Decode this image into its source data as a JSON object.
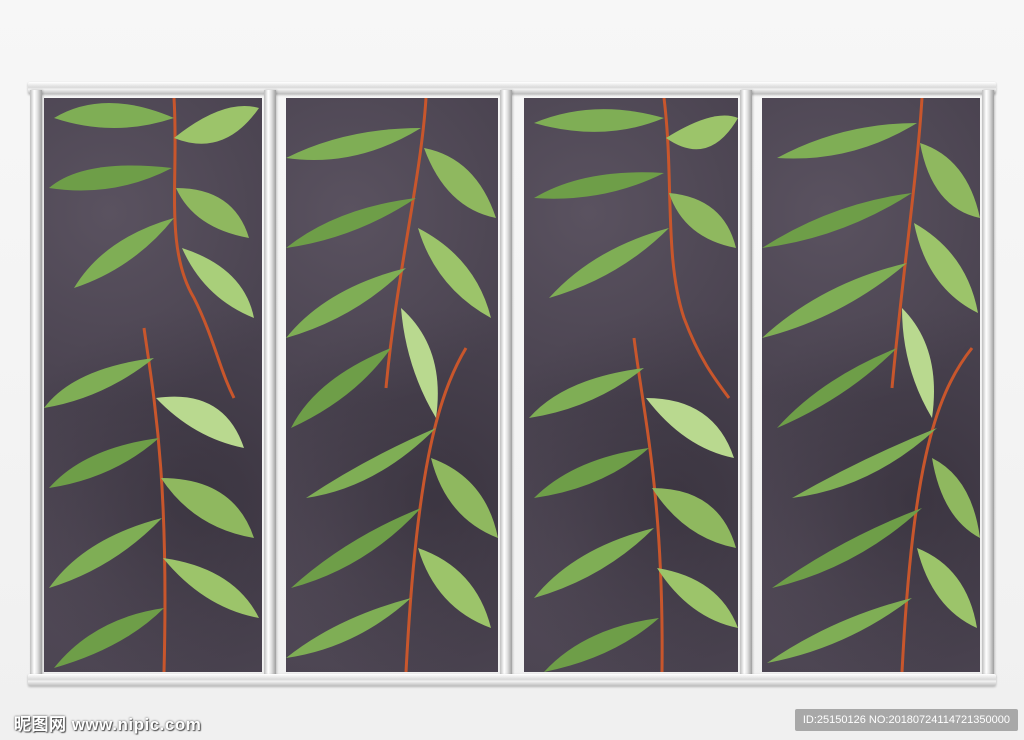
{
  "image": {
    "subject": "Four-panel botanical watercolor mural in a silver frame",
    "colors": {
      "panel_background": "#4a4350",
      "leaf_green": "#7fae55",
      "leaf_light": "#b9d98f",
      "stem": "#c8562c",
      "frame": "#d9d9d9"
    }
  },
  "watermark": {
    "site": "昵图网 www.nipic.com",
    "id": "ID:25150126 NO:20180724114721350000"
  }
}
